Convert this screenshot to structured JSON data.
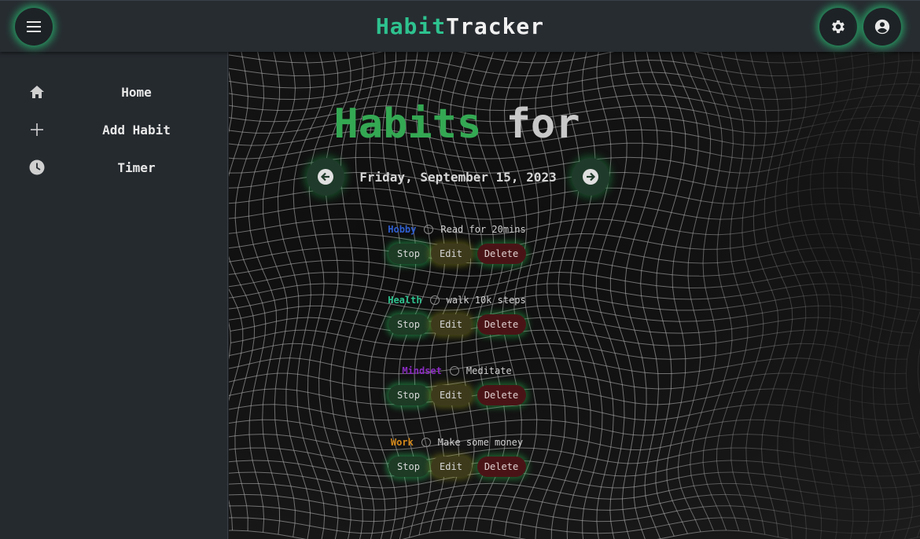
{
  "header": {
    "title_part1": "Habit",
    "title_part2": "Tracker",
    "menu_icon": "hamburger-menu-icon",
    "settings_icon": "gear-icon",
    "account_icon": "account-circle-icon",
    "accent_color": "#2ec28f"
  },
  "sidebar": {
    "items": [
      {
        "label": "Home",
        "icon": "home-icon"
      },
      {
        "label": "Add Habit",
        "icon": "plus-icon"
      },
      {
        "label": "Timer",
        "icon": "clock-icon"
      }
    ]
  },
  "main": {
    "heading_part1": "Habits",
    "heading_part2": "for",
    "date": "Friday, September 15, 2023",
    "prev_icon": "arrow-left-circle-icon",
    "next_icon": "arrow-right-circle-icon",
    "buttons": {
      "stop": "Stop",
      "edit": "Edit",
      "delete": "Delete"
    },
    "habits": [
      {
        "category": "Hobby",
        "category_color": "#2f5fd0",
        "name": "Read for 20mins"
      },
      {
        "category": "Health",
        "category_color": "#2ec28f",
        "name": "walk 10k steps"
      },
      {
        "category": "Mindset",
        "category_color": "#8a2bc0",
        "name": "Meditate"
      },
      {
        "category": "Work",
        "category_color": "#d58a1a",
        "name": "Make some money"
      }
    ]
  }
}
